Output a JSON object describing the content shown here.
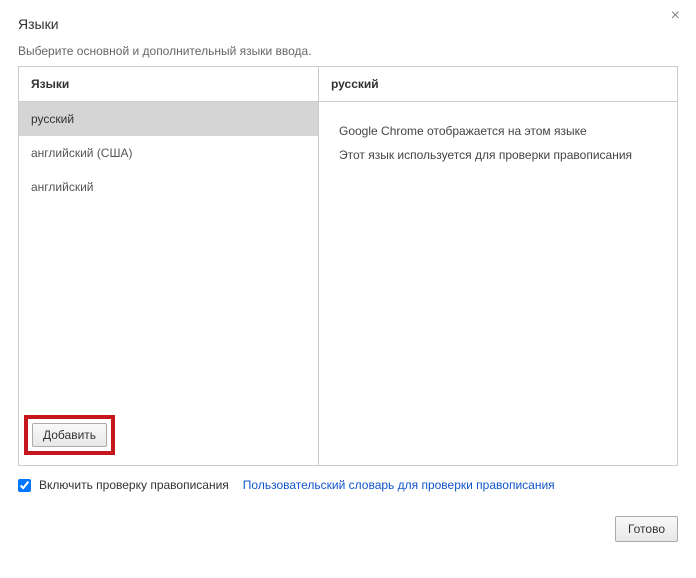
{
  "title": "Языки",
  "subtitle": "Выберите основной и дополнительный языки ввода.",
  "leftHeader": "Языки",
  "languages": [
    {
      "name": "русский",
      "selected": true
    },
    {
      "name": "английский (США)",
      "selected": false
    },
    {
      "name": "английский",
      "selected": false
    }
  ],
  "addButton": "Добавить",
  "rightHeader": "русский",
  "info": {
    "display": "Google Chrome отображается на этом языке",
    "spellcheck": "Этот язык используется для проверки правописания"
  },
  "spellcheckCheckbox": {
    "label": "Включить проверку правописания",
    "checked": true
  },
  "customDictLink": "Пользовательский словарь для проверки правописания",
  "doneButton": "Готово"
}
